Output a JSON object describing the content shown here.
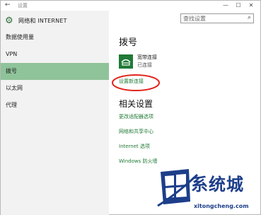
{
  "window": {
    "title": "设置",
    "back_glyph": "←",
    "controls": [
      "—",
      "☐",
      "✕"
    ]
  },
  "header": {
    "title": "网络和 INTERNET"
  },
  "search": {
    "placeholder": "查找设置"
  },
  "nav": {
    "items": [
      {
        "label": "数据使用量"
      },
      {
        "label": "VPN"
      },
      {
        "label": "拨号"
      },
      {
        "label": "以太网"
      },
      {
        "label": "代理"
      }
    ],
    "selected_index": 2
  },
  "main": {
    "section_title": "拨号",
    "connection": {
      "name": "宽带连接",
      "status": "已连接",
      "icon": "dialup-icon"
    },
    "setup_link": "设置新连接",
    "related_title": "相关设置",
    "related_links": [
      {
        "label": "更改适配器选项"
      },
      {
        "label": "网络和共享中心"
      },
      {
        "label": "Internet 选项"
      },
      {
        "label": "Windows 防火墙"
      }
    ]
  },
  "watermark": {
    "text": "系统城",
    "url": "xitongcheng.com"
  },
  "colors": {
    "accent": "#1f7a36",
    "nav_selected": "#8fc39a",
    "sidebar_bg": "#f2f2f2",
    "annotation": "#e0241b"
  }
}
